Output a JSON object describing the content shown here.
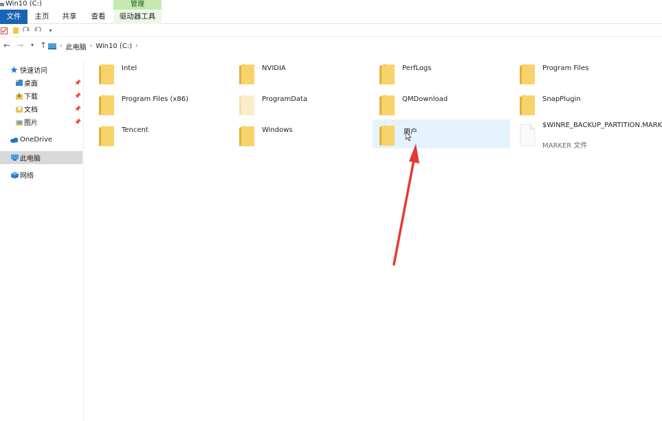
{
  "window": {
    "title": "Win10 (C:)"
  },
  "ribbon": {
    "context_header": "管理",
    "tabs": [
      {
        "label": "文件"
      },
      {
        "label": "主页"
      },
      {
        "label": "共享"
      },
      {
        "label": "查看"
      },
      {
        "label": "驱动器工具"
      }
    ]
  },
  "address": {
    "crumbs": [
      "此电脑",
      "Win10 (C:)"
    ]
  },
  "sidebar": {
    "quick_access": "快速访问",
    "items": [
      {
        "label": "桌面"
      },
      {
        "label": "下载"
      },
      {
        "label": "文档"
      },
      {
        "label": "图片"
      }
    ],
    "onedrive": "OneDrive",
    "this_pc": "此电脑",
    "network": "网络"
  },
  "files": [
    {
      "name": "Intel"
    },
    {
      "name": "NVIDIA"
    },
    {
      "name": "PerfLogs"
    },
    {
      "name": "Program Files"
    },
    {
      "name": "Program Files (x86)"
    },
    {
      "name": "ProgramData"
    },
    {
      "name": "QMDownload"
    },
    {
      "name": "SnapPlugin"
    },
    {
      "name": "Tencent"
    },
    {
      "name": "Windows"
    },
    {
      "name": "用户"
    },
    {
      "name": "$WINRE_BACKUP_PARTITION.MARKER",
      "type": "MARKER 文件"
    }
  ],
  "colors": {
    "file_tab": "#1965b5",
    "context_tab": "#c5e9b1",
    "selection": "#e5f3ff",
    "folder": "#f8d26a",
    "annotation_arrow": "#e53935"
  }
}
